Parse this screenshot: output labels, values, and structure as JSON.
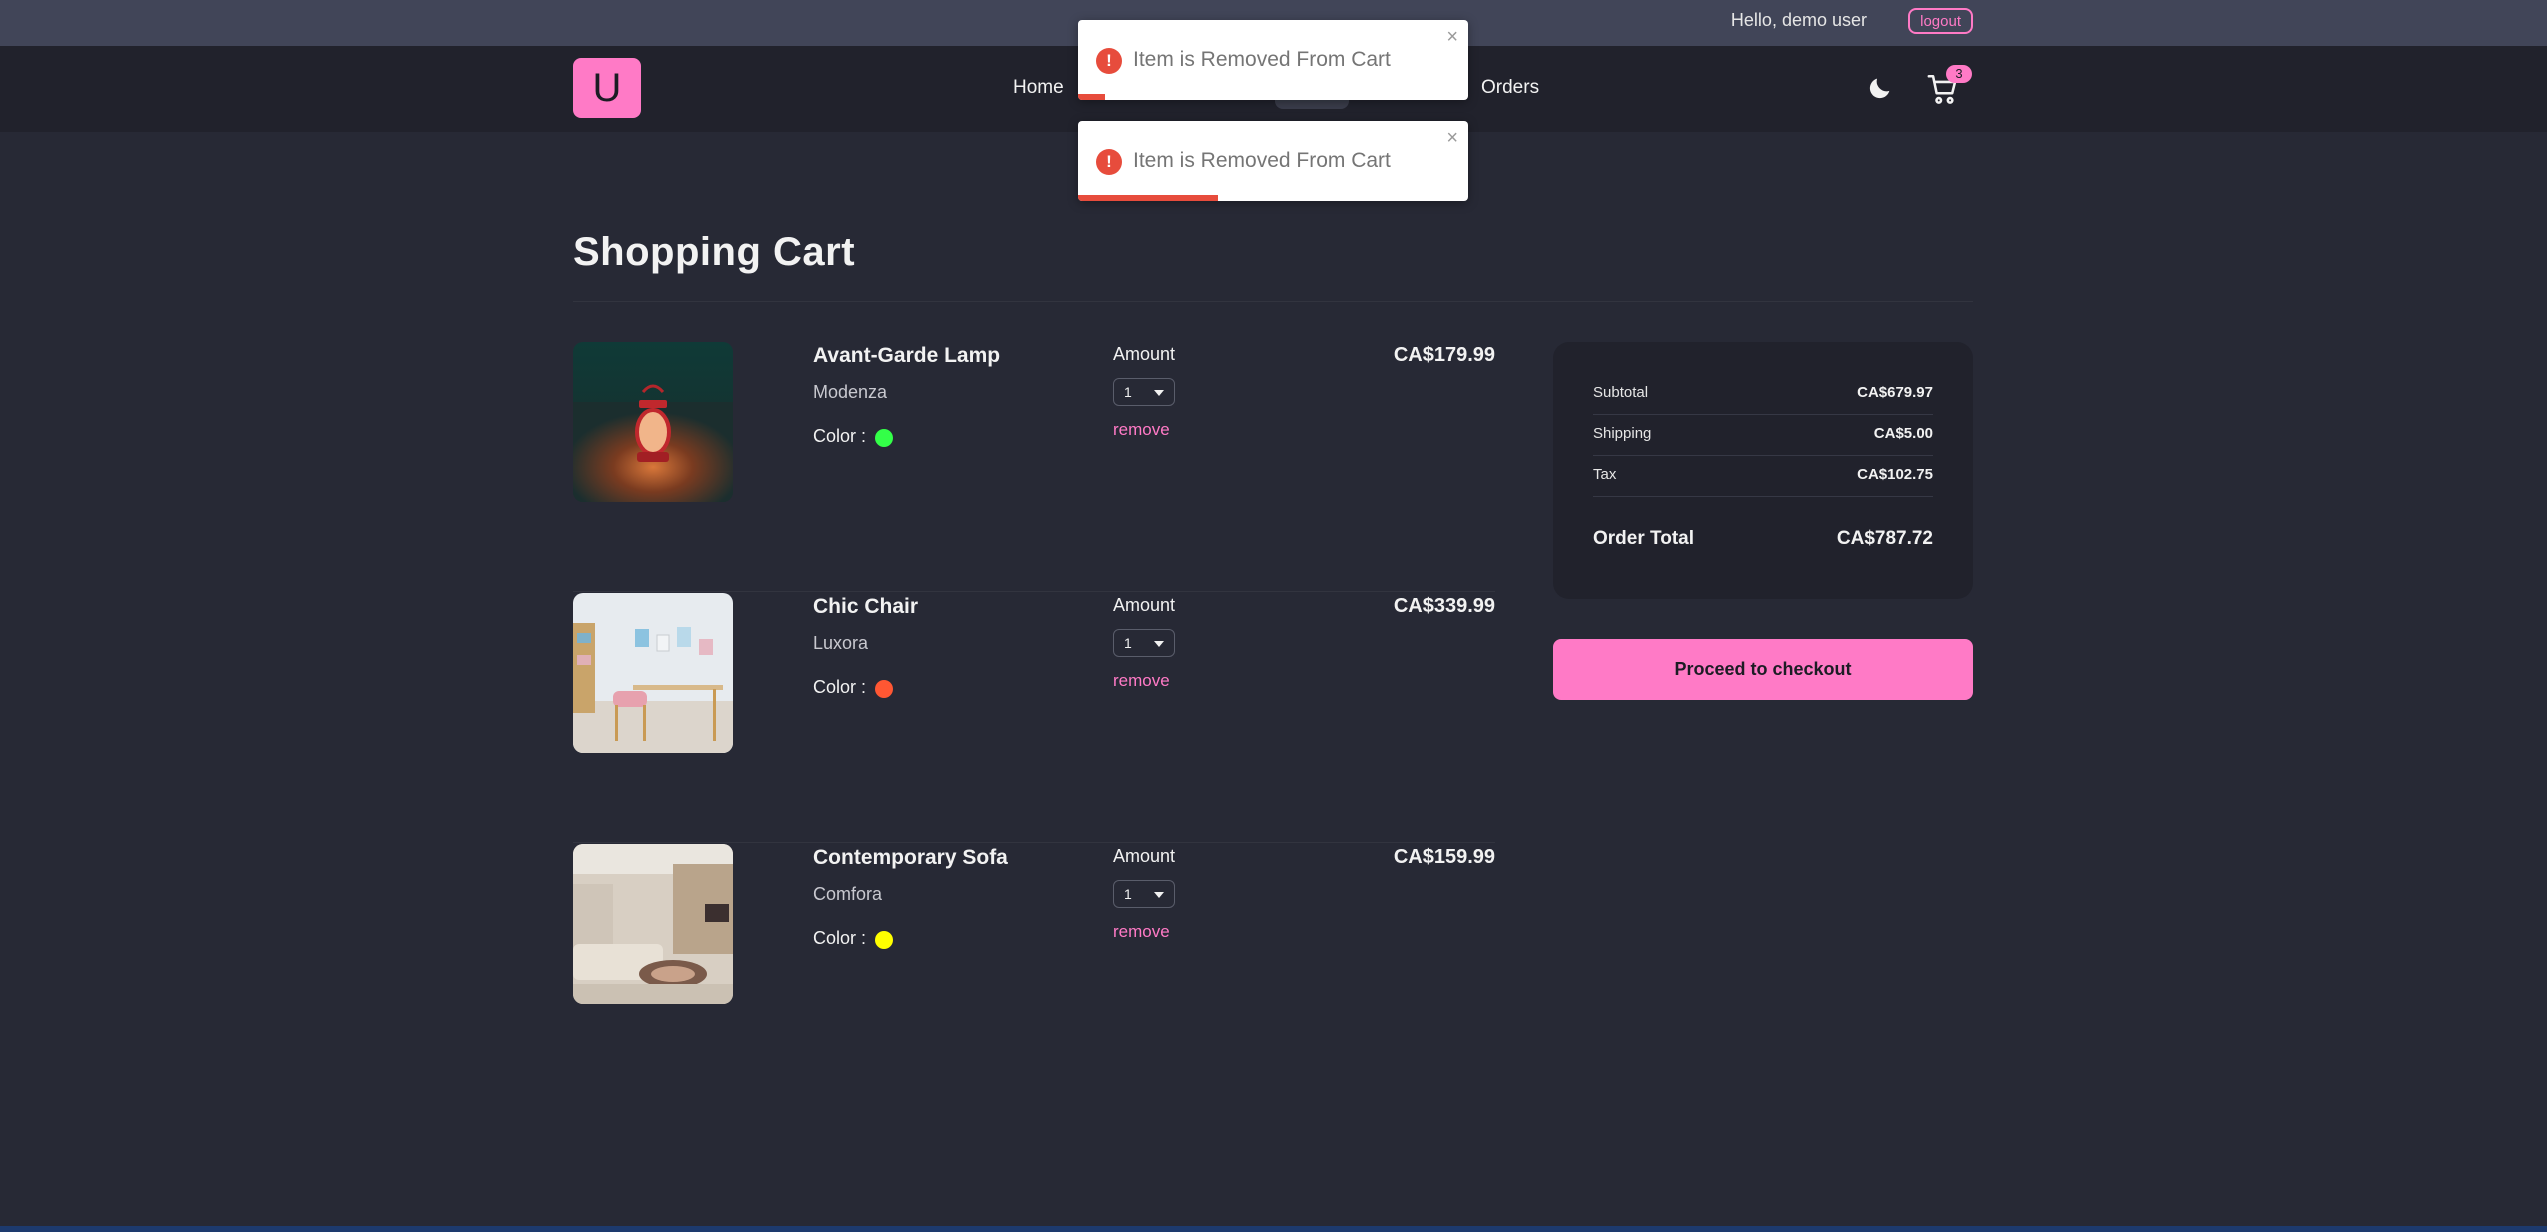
{
  "topbar": {
    "greeting": "Hello, demo user",
    "logout_label": "logout"
  },
  "navbar": {
    "logo_letter": "U",
    "links": [
      "Home",
      "Orders"
    ],
    "cart_count": "3"
  },
  "toasts": [
    {
      "message": "Item is Removed From Cart",
      "close": "×",
      "progress": 0.07
    },
    {
      "message": "Item is Removed From Cart",
      "close": "×",
      "progress": 0.36
    }
  ],
  "cart": {
    "title": "Shopping Cart",
    "amount_label": "Amount",
    "color_label": "Color :",
    "remove_label": "remove",
    "items": [
      {
        "name": "Avant-Garde Lamp",
        "company": "Modenza",
        "color": "#33ff48",
        "amount": "1",
        "price": "CA$179.99"
      },
      {
        "name": "Chic Chair",
        "company": "Luxora",
        "color": "#ff5733",
        "amount": "1",
        "price": "CA$339.99"
      },
      {
        "name": "Contemporary Sofa",
        "company": "Comfora",
        "color": "#ffff00",
        "amount": "1",
        "price": "CA$159.99"
      }
    ]
  },
  "summary": {
    "subtotal_label": "Subtotal",
    "subtotal": "CA$679.97",
    "shipping_label": "Shipping",
    "shipping": "CA$5.00",
    "tax_label": "Tax",
    "tax": "CA$102.75",
    "total_label": "Order Total",
    "total": "CA$787.72"
  },
  "checkout_label": "Proceed to checkout",
  "colors": {
    "accent": "#ff7ac6",
    "error": "#e74c3c",
    "background": "#272935"
  }
}
